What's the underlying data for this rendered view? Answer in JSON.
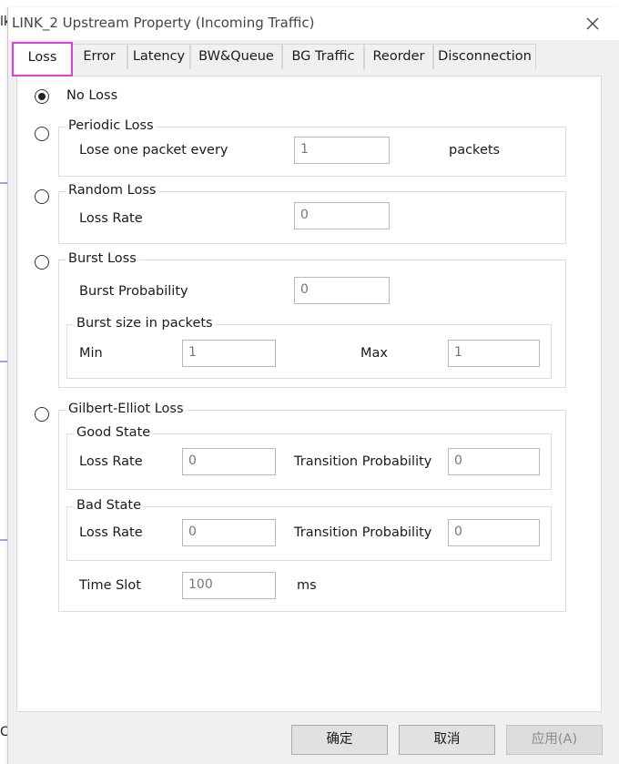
{
  "background": {
    "left_fragment": "lk",
    "bottom_fragment": "Ce"
  },
  "window": {
    "title": "LINK_2 Upstream Property (Incoming Traffic)",
    "close_glyph": "✕"
  },
  "tabs": [
    {
      "label": "Loss"
    },
    {
      "label": "Error"
    },
    {
      "label": "Latency"
    },
    {
      "label": "BW&Queue"
    },
    {
      "label": "BG  Traffic"
    },
    {
      "label": "Reorder"
    },
    {
      "label": "Disconnection"
    }
  ],
  "loss": {
    "no_loss": {
      "label": "No Loss",
      "selected": true
    },
    "periodic": {
      "label": "Periodic Loss",
      "every_label": "Lose one packet every",
      "every_value": "1",
      "unit": "packets"
    },
    "random": {
      "label": "Random Loss",
      "rate_label": "Loss Rate",
      "rate_value": "0"
    },
    "burst": {
      "label": "Burst Loss",
      "prob_label": "Burst Probability",
      "prob_value": "0",
      "size_group": "Burst size in packets",
      "min_label": "Min",
      "min_value": "1",
      "max_label": "Max",
      "max_value": "1"
    },
    "gilbert": {
      "label": "Gilbert-Elliot Loss",
      "good": {
        "title": "Good State",
        "rate_label": "Loss Rate",
        "rate_value": "0",
        "trans_label": "Transition Probability",
        "trans_value": "0"
      },
      "bad": {
        "title": "Bad State",
        "rate_label": "Loss Rate",
        "rate_value": "0",
        "trans_label": "Transition Probability",
        "trans_value": "0"
      },
      "slot_label": "Time Slot",
      "slot_value": "100",
      "slot_unit": "ms"
    }
  },
  "buttons": {
    "ok": "确定",
    "cancel": "取消",
    "apply": "应用(A)"
  }
}
